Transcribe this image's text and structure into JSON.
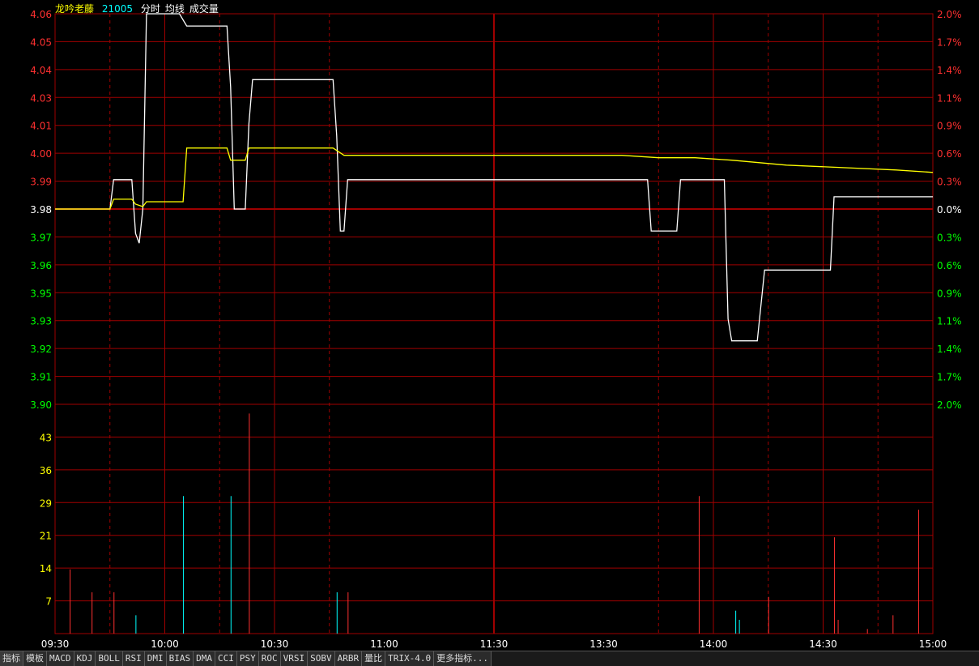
{
  "header": {
    "name": "龙吟老藤",
    "code": "21005",
    "labels": [
      "分时",
      "均线",
      "成交量"
    ]
  },
  "colors": {
    "up": "#ff3030",
    "down": "#00ff00",
    "base": "#ffffff",
    "grid": "#a00000",
    "price_line": "#ffffff",
    "avg_line": "#ffff00",
    "vol_up": "#ff3030",
    "vol_down": "#00ffff",
    "vol_axis": "#ffff00"
  },
  "chart_data": {
    "type": "line",
    "title": "",
    "base_price": 3.98,
    "price_ticks": [
      "4.06",
      "4.05",
      "4.04",
      "4.03",
      "4.01",
      "4.00",
      "3.99",
      "3.98",
      "3.97",
      "3.96",
      "3.95",
      "3.93",
      "3.92",
      "3.91",
      "3.90"
    ],
    "pct_ticks": [
      "2.0%",
      "1.7%",
      "1.4%",
      "1.1%",
      "0.9%",
      "0.6%",
      "0.3%",
      "0.0%",
      "0.3%",
      "0.6%",
      "0.9%",
      "1.1%",
      "1.4%",
      "1.7%",
      "2.0%"
    ],
    "ylim": [
      3.9,
      4.06
    ],
    "vol_ticks": [
      "43",
      "36",
      "29",
      "21",
      "14",
      "7"
    ],
    "vol_ylim": [
      0,
      50
    ],
    "time_ticks": [
      "09:30",
      "10:00",
      "10:30",
      "11:00",
      "11:30",
      "13:30",
      "14:00",
      "14:30",
      "15:00"
    ],
    "minutes_total": 240,
    "series": [
      {
        "name": "分时",
        "points": [
          [
            0,
            3.98
          ],
          [
            15,
            3.98
          ],
          [
            16,
            3.992
          ],
          [
            21,
            3.992
          ],
          [
            22,
            3.97
          ],
          [
            23,
            3.966
          ],
          [
            24,
            3.98
          ],
          [
            25,
            4.06
          ],
          [
            34,
            4.06
          ],
          [
            36,
            4.055
          ],
          [
            47,
            4.055
          ],
          [
            48,
            4.03
          ],
          [
            49,
            3.98
          ],
          [
            52,
            3.98
          ],
          [
            53,
            4.015
          ],
          [
            54,
            4.033
          ],
          [
            76,
            4.033
          ],
          [
            77,
            4.01
          ],
          [
            78,
            3.971
          ],
          [
            79,
            3.971
          ],
          [
            80,
            3.992
          ],
          [
            162,
            3.992
          ],
          [
            163,
            3.971
          ],
          [
            170,
            3.971
          ],
          [
            171,
            3.992
          ],
          [
            183,
            3.992
          ],
          [
            184,
            3.935
          ],
          [
            185,
            3.926
          ],
          [
            192,
            3.926
          ],
          [
            194,
            3.955
          ],
          [
            212,
            3.955
          ],
          [
            213,
            3.985
          ],
          [
            240,
            3.985
          ]
        ]
      },
      {
        "name": "均线",
        "points": [
          [
            0,
            3.98
          ],
          [
            15,
            3.98
          ],
          [
            16,
            3.984
          ],
          [
            21,
            3.984
          ],
          [
            22,
            3.982
          ],
          [
            24,
            3.981
          ],
          [
            25,
            3.983
          ],
          [
            35,
            3.983
          ],
          [
            36,
            4.005
          ],
          [
            47,
            4.005
          ],
          [
            48,
            4.0
          ],
          [
            52,
            4.0
          ],
          [
            53,
            4.005
          ],
          [
            76,
            4.005
          ],
          [
            77,
            4.004
          ],
          [
            79,
            4.002
          ],
          [
            155,
            4.002
          ],
          [
            165,
            4.001
          ],
          [
            175,
            4.001
          ],
          [
            185,
            4.0
          ],
          [
            200,
            3.998
          ],
          [
            230,
            3.996
          ],
          [
            240,
            3.995
          ]
        ]
      }
    ],
    "volume": [
      {
        "t": 4,
        "v": 14,
        "c": "up"
      },
      {
        "t": 10,
        "v": 9,
        "c": "up"
      },
      {
        "t": 16,
        "v": 9,
        "c": "up"
      },
      {
        "t": 22,
        "v": 4,
        "c": "down"
      },
      {
        "t": 35,
        "v": 30,
        "c": "down"
      },
      {
        "t": 48,
        "v": 30,
        "c": "down"
      },
      {
        "t": 53,
        "v": 48,
        "c": "up"
      },
      {
        "t": 77,
        "v": 9,
        "c": "down"
      },
      {
        "t": 80,
        "v": 9,
        "c": "up"
      },
      {
        "t": 176,
        "v": 30,
        "c": "up"
      },
      {
        "t": 186,
        "v": 5,
        "c": "down"
      },
      {
        "t": 187,
        "v": 3,
        "c": "down"
      },
      {
        "t": 195,
        "v": 8,
        "c": "up"
      },
      {
        "t": 213,
        "v": 21,
        "c": "up"
      },
      {
        "t": 214,
        "v": 3,
        "c": "up"
      },
      {
        "t": 222,
        "v": 1,
        "c": "up"
      },
      {
        "t": 229,
        "v": 4,
        "c": "up"
      },
      {
        "t": 236,
        "v": 27,
        "c": "up"
      }
    ]
  },
  "tabs": [
    "指标",
    "模板",
    "MACD",
    "KDJ",
    "BOLL",
    "RSI",
    "DMI",
    "BIAS",
    "DMA",
    "CCI",
    "PSY",
    "ROC",
    "VRSI",
    "SOBV",
    "ARBR",
    "量比",
    "TRIX-4.0",
    "更多指标..."
  ]
}
